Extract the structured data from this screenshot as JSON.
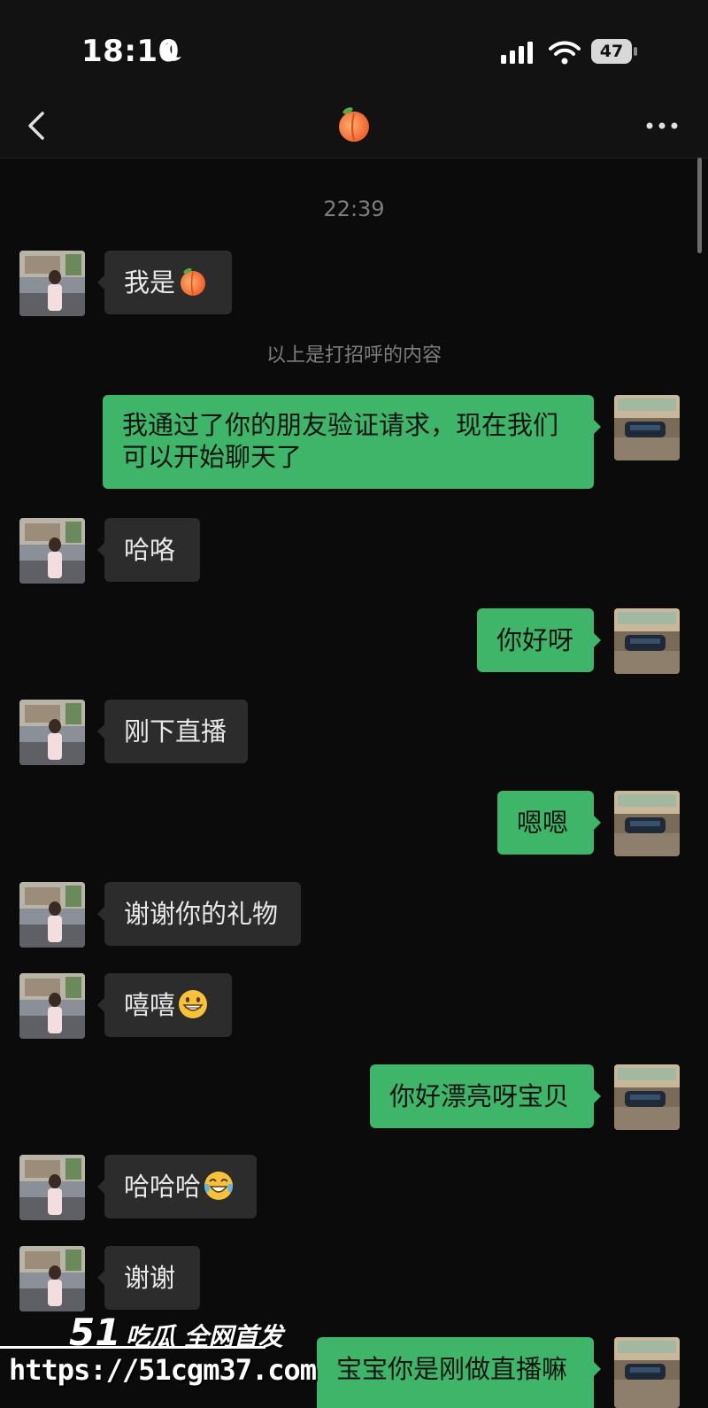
{
  "status_bar": {
    "time": "18:10",
    "battery": "47"
  },
  "nav": {
    "title_icon": "peach-emoji",
    "back_icon": "chevron-left-icon",
    "more_icon": "more-dots-icon"
  },
  "chat": {
    "timestamp": "22:39",
    "system_note": "以上是打招呼的内容",
    "messages": [
      {
        "dir": "in",
        "text": "我是",
        "emoji": "peach-emoji"
      },
      {
        "dir": "out",
        "text": "我通过了你的朋友验证请求，现在我们",
        "text2": "可以开始聊天了"
      },
      {
        "dir": "in",
        "text": "哈咯"
      },
      {
        "dir": "out",
        "text": "你好呀"
      },
      {
        "dir": "in",
        "text": "刚下直播"
      },
      {
        "dir": "out",
        "text": "嗯嗯"
      },
      {
        "dir": "in",
        "text": "谢谢你的礼物"
      },
      {
        "dir": "in",
        "text": "嘻嘻",
        "emoji": "grinning-face-emoji"
      },
      {
        "dir": "out",
        "text": "你好漂亮呀宝贝"
      },
      {
        "dir": "in",
        "text": "哈哈哈",
        "emoji": "tears-of-joy-emoji"
      },
      {
        "dir": "in",
        "text": "谢谢"
      },
      {
        "dir": "out",
        "text": "宝宝你是刚做直播嘛"
      }
    ]
  },
  "watermark": {
    "num": "51",
    "text": "吃瓜 全网首发",
    "url": "https://51cgm37.com"
  },
  "colors": {
    "outgoing_bubble": "#3fb569",
    "incoming_bubble": "#2c2c2c",
    "background": "#0b0b0b"
  }
}
